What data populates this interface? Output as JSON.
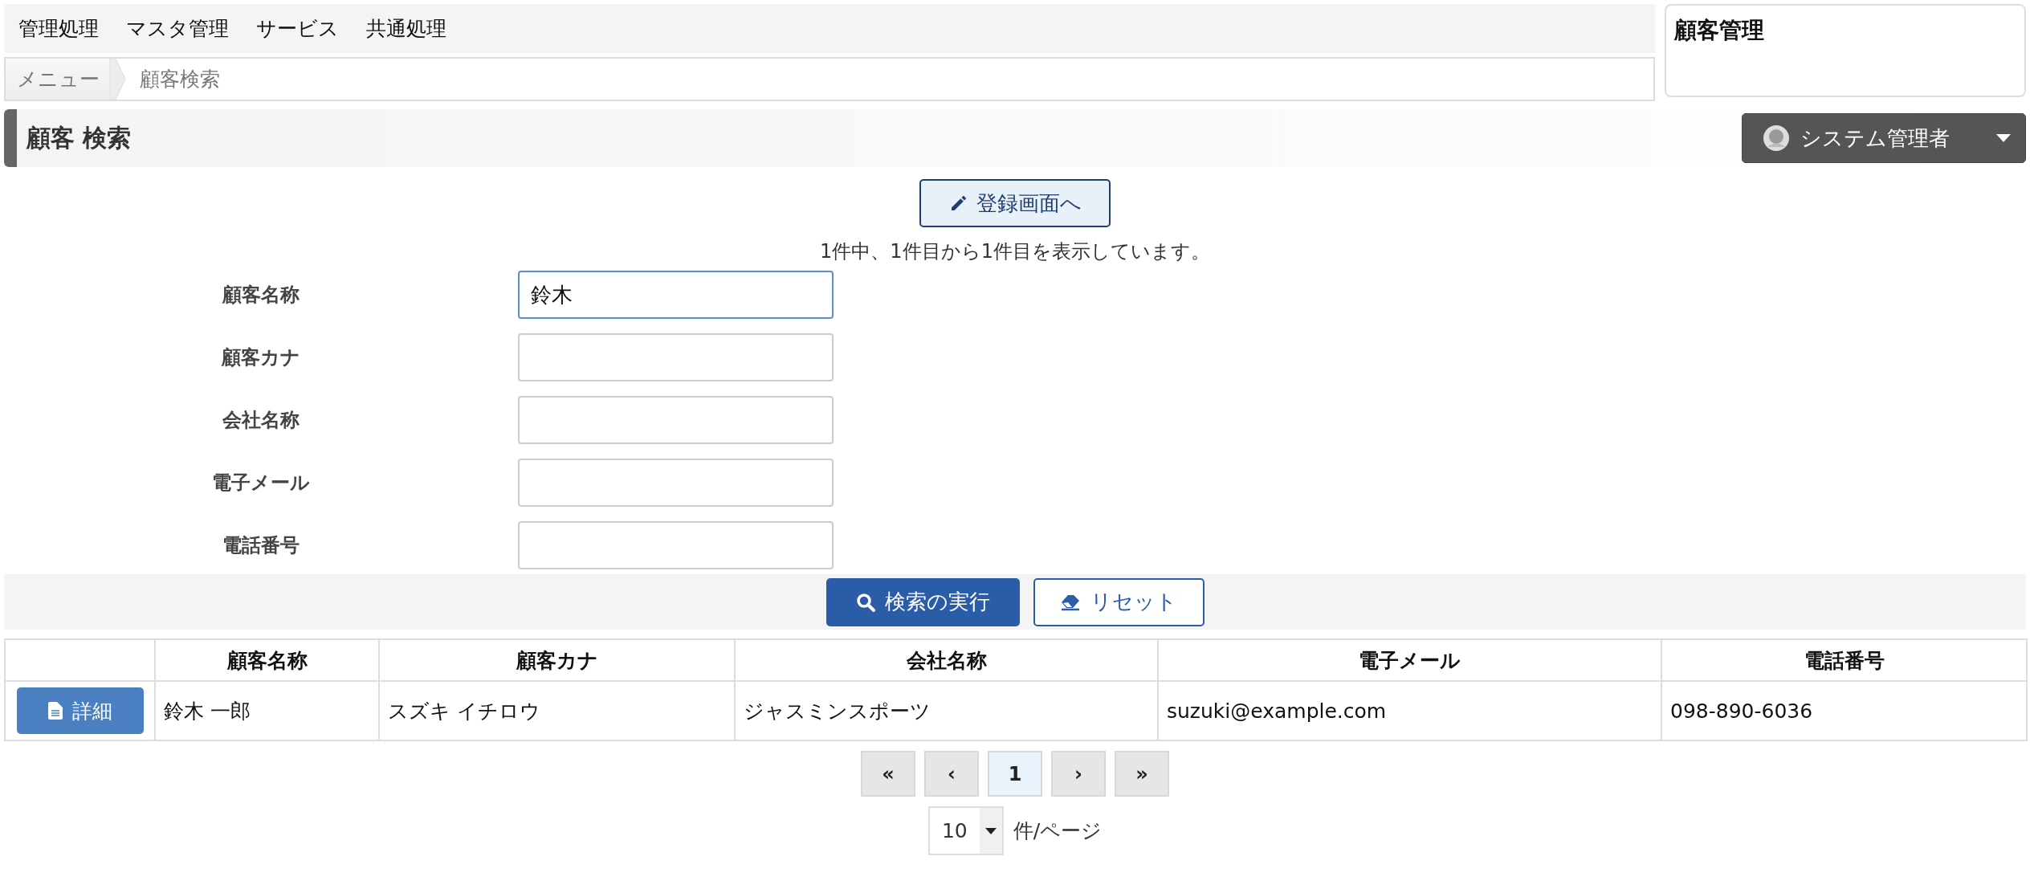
{
  "menu": [
    {
      "label": "管理処理"
    },
    {
      "label": "マスタ管理"
    },
    {
      "label": "サービス"
    },
    {
      "label": "共通処理"
    }
  ],
  "header_panel": {
    "title": "顧客管理"
  },
  "breadcrumb": [
    {
      "label": "メニュー"
    },
    {
      "label": "顧客検索"
    }
  ],
  "page_title": "顧客 検索",
  "user_menu": {
    "label": "システム管理者"
  },
  "register_button": "登録画面へ",
  "result_summary": "1件中、1件目から1件目を表示しています。",
  "search_form": {
    "fields": [
      {
        "label": "顧客名称",
        "value": "鈴木",
        "focused": true
      },
      {
        "label": "顧客カナ",
        "focused": false
      },
      {
        "label": "会社名称",
        "focused": false
      },
      {
        "label": "電子メール",
        "focused": false
      },
      {
        "label": "電話番号",
        "focused": false
      }
    ]
  },
  "search_button": "検索の実行",
  "reset_button": "リセット",
  "table": {
    "columns": [
      "顧客名称",
      "顧客カナ",
      "会社名称",
      "電子メール",
      "電話番号"
    ],
    "rows": [
      {
        "action": "詳細",
        "cells": [
          "鈴木 一郎",
          "スズキ イチロウ",
          "ジャスミンスポーツ",
          "suzuki@example.com",
          "098-890-6036"
        ]
      }
    ]
  },
  "pagination": [
    {
      "label": "«",
      "selected": false
    },
    {
      "label": "‹",
      "selected": false
    },
    {
      "label": "1",
      "selected": true
    },
    {
      "label": "›",
      "selected": false
    },
    {
      "label": "»",
      "selected": false
    }
  ],
  "page_size": {
    "value": "10",
    "unit_label": "件/ページ"
  }
}
